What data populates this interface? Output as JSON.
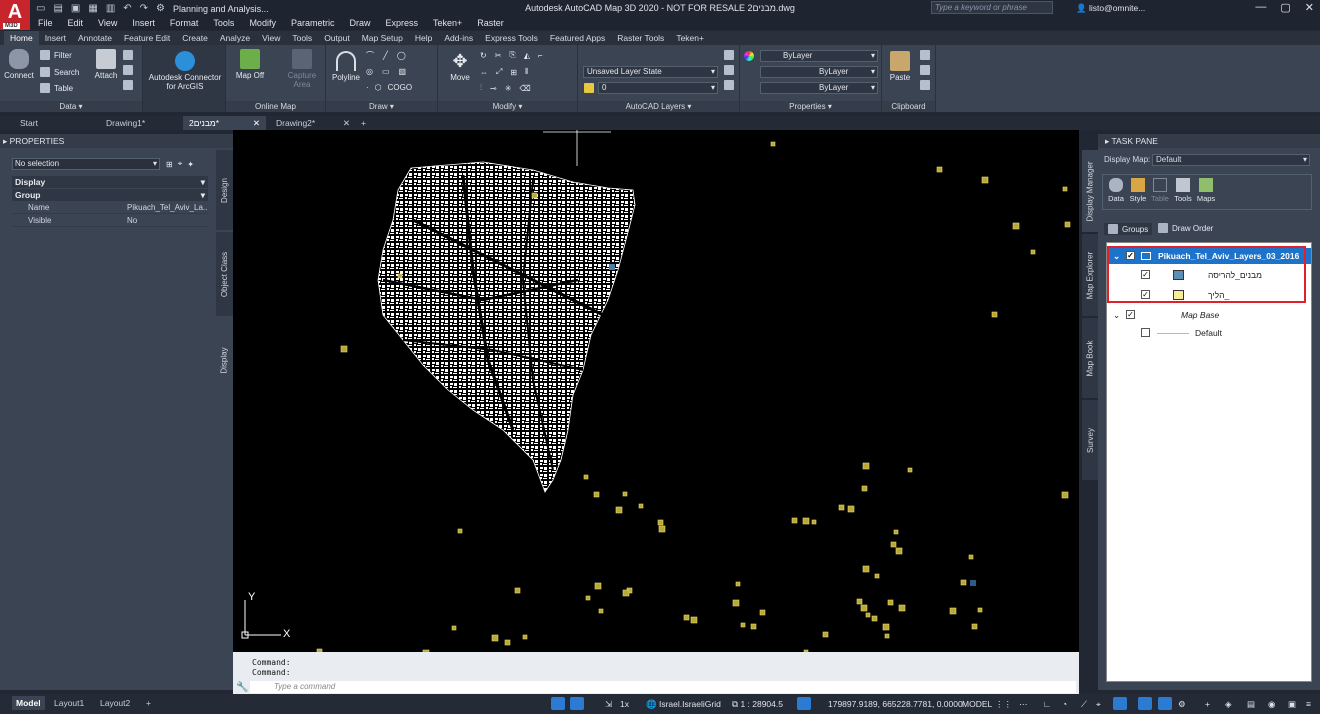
{
  "titlebar": {
    "logo": "A",
    "logo_sub": "M3D",
    "workspace": "Planning and Analysis...",
    "title": "Autodesk AutoCAD Map 3D 2020 - NOT FOR RESALE  מבנים2.dwg",
    "search_placeholder": "Type a keyword or phrase",
    "user": "listo@omnite...",
    "help": "?"
  },
  "menu": [
    "File",
    "Edit",
    "View",
    "Insert",
    "Format",
    "Tools",
    "Modify",
    "Parametric",
    "Draw",
    "Express",
    "Teken+",
    "Raster"
  ],
  "ribbon_tabs": [
    "Home",
    "Insert",
    "Annotate",
    "Feature Edit",
    "Create",
    "Analyze",
    "View",
    "Tools",
    "Output",
    "Map Setup",
    "Help",
    "Add-ins",
    "Express Tools",
    "Featured Apps",
    "Raster Tools",
    "Teken+"
  ],
  "ribbon": {
    "data": {
      "title": "Data",
      "connect": "Connect",
      "filter": "Filter",
      "search": "Search",
      "table": "Table",
      "attach": "Attach"
    },
    "connector": {
      "label1": "Autodesk Connector",
      "label2": "for ArcGIS"
    },
    "online_map": {
      "title": "Online Map",
      "map_off": "Map Off",
      "capture1": "Capture",
      "capture2": "Area"
    },
    "draw": {
      "title": "Draw",
      "polyline": "Polyline",
      "cogo": "COGO"
    },
    "modify": {
      "title": "Modify",
      "move": "Move"
    },
    "layers": {
      "title": "AutoCAD Layers",
      "layer_state": "Unsaved Layer State",
      "layer_current": "0"
    },
    "properties": {
      "title": "Properties",
      "color": "ByLayer",
      "linetype": "ByLayer",
      "lineweight": "ByLayer"
    },
    "clipboard": {
      "title": "Clipboard",
      "paste": "Paste"
    }
  },
  "doc_tabs": [
    "Start",
    "Drawing1*",
    "מבנים2*",
    "Drawing2*"
  ],
  "properties": {
    "header": "PROPERTIES",
    "selection": "No selection",
    "section_display": "Display",
    "section_group": "Group",
    "rows": [
      {
        "key": "Name",
        "value": "Pikuach_Tel_Aviv_La..."
      },
      {
        "key": "Visible",
        "value": "No"
      }
    ],
    "side_tabs": [
      "Design",
      "Object Class",
      "Display"
    ]
  },
  "command": {
    "line1": "Command:",
    "line2": "Command:",
    "placeholder": "Type a command"
  },
  "taskpane": {
    "header": "TASK PANE",
    "display_map_label": "Display Map:",
    "display_map_value": "Default",
    "tools": [
      "Data",
      "Style",
      "Table",
      "Tools",
      "Maps"
    ],
    "groups": "Groups",
    "draw_order": "Draw Order",
    "side_tabs": [
      "Display Manager",
      "Map Explorer",
      "Map Book",
      "Survey"
    ],
    "tree": {
      "group": "Pikuach_Tel_Aviv_Layers_03_2016",
      "layer1": "מבנים_להריסה",
      "layer2": "הליך_",
      "map_base": "Map Base",
      "default": "Default"
    }
  },
  "status": {
    "tabs": [
      "Model",
      "Layout1",
      "Layout2"
    ],
    "scale_label": "1x",
    "crs": "Israel.IsraeliGrid",
    "viewport_scale": "1 : 28904.5",
    "coords": "179897.9189, 665228.7781, 0.0000",
    "model": "MODEL"
  },
  "colors": {
    "accent": "#1d73c9",
    "highlight": "#e0202a",
    "building": "#ffffff",
    "parcel": "#d6c54a",
    "blue_swatch": "#5b8fb3",
    "yellow_swatch": "#f5ec9a"
  }
}
